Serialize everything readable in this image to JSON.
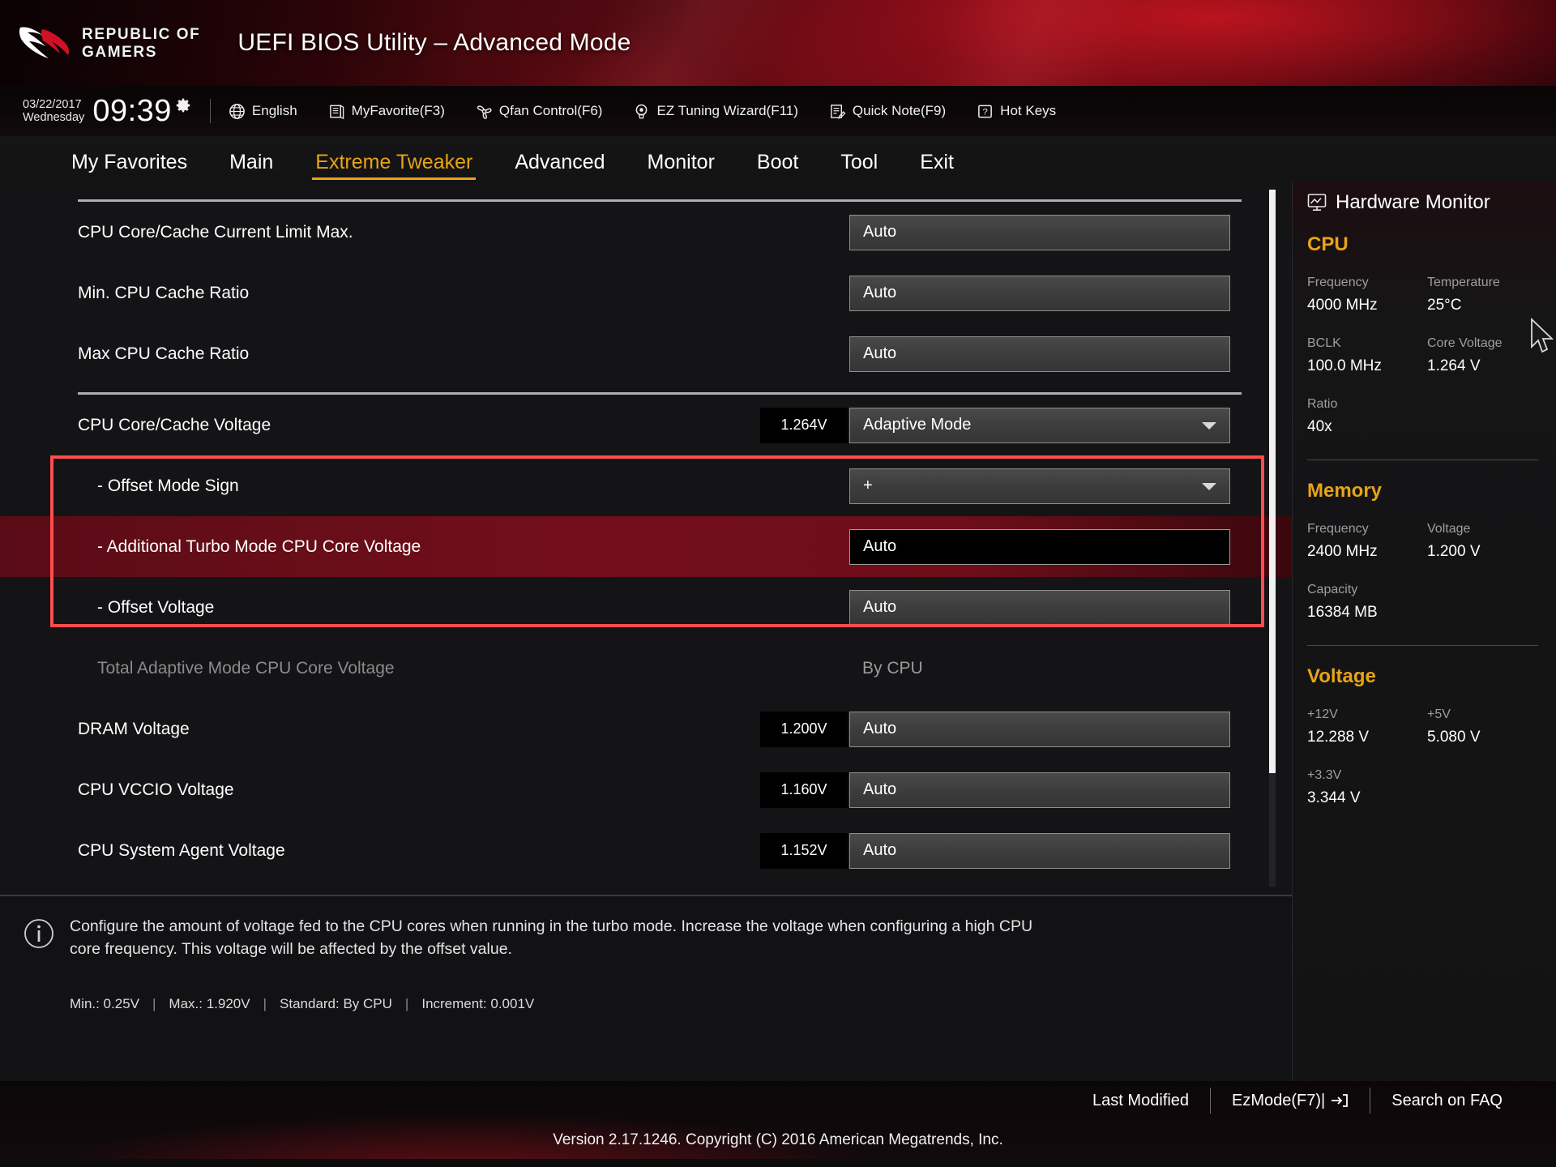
{
  "header": {
    "brand_line1": "REPUBLIC OF",
    "brand_line2": "GAMERS",
    "title": "UEFI BIOS Utility – Advanced Mode"
  },
  "toolbar": {
    "date": "03/22/2017",
    "weekday": "Wednesday",
    "time": "09:39",
    "items": [
      {
        "label": "English",
        "icon": "globe-icon"
      },
      {
        "label": "MyFavorite(F3)",
        "icon": "bookmark-icon"
      },
      {
        "label": "Qfan Control(F6)",
        "icon": "fan-icon"
      },
      {
        "label": "EZ Tuning Wizard(F11)",
        "icon": "wizard-icon"
      },
      {
        "label": "Quick Note(F9)",
        "icon": "note-icon"
      },
      {
        "label": "Hot Keys",
        "icon": "key-icon"
      }
    ]
  },
  "nav": {
    "tabs": [
      {
        "label": "My Favorites",
        "active": false
      },
      {
        "label": "Main",
        "active": false
      },
      {
        "label": "Extreme Tweaker",
        "active": true
      },
      {
        "label": "Advanced",
        "active": false
      },
      {
        "label": "Monitor",
        "active": false
      },
      {
        "label": "Boot",
        "active": false
      },
      {
        "label": "Tool",
        "active": false
      },
      {
        "label": "Exit",
        "active": false
      }
    ],
    "active_color": "#e8a317"
  },
  "settings": {
    "rows": [
      {
        "label": "CPU Core/Cache Current Limit Max.",
        "value": "Auto",
        "control": "field",
        "voltage": "",
        "sub": false,
        "dim": false,
        "selected": false
      },
      {
        "label": "Min. CPU Cache Ratio",
        "value": "Auto",
        "control": "field",
        "voltage": "",
        "sub": false,
        "dim": false,
        "selected": false
      },
      {
        "label": "Max CPU Cache Ratio",
        "value": "Auto",
        "control": "field",
        "voltage": "",
        "sub": false,
        "dim": false,
        "selected": false
      },
      {
        "label": "CPU Core/Cache Voltage",
        "value": "Adaptive Mode",
        "control": "dropdown",
        "voltage": "1.264V",
        "sub": false,
        "dim": false,
        "selected": false
      },
      {
        "label": "- Offset Mode Sign",
        "value": "+",
        "control": "dropdown",
        "voltage": "",
        "sub": true,
        "dim": false,
        "selected": false
      },
      {
        "label": "- Additional Turbo Mode CPU Core Voltage",
        "value": "Auto",
        "control": "field-dark",
        "voltage": "",
        "sub": true,
        "dim": false,
        "selected": true
      },
      {
        "label": "- Offset Voltage",
        "value": "Auto",
        "control": "field",
        "voltage": "",
        "sub": true,
        "dim": false,
        "selected": false
      },
      {
        "label": "Total Adaptive Mode CPU Core Voltage",
        "value": "By CPU",
        "control": "plain",
        "voltage": "",
        "sub": true,
        "dim": true,
        "selected": false
      },
      {
        "label": "DRAM Voltage",
        "value": "Auto",
        "control": "field",
        "voltage": "1.200V",
        "sub": false,
        "dim": false,
        "selected": false
      },
      {
        "label": "CPU VCCIO Voltage",
        "value": "Auto",
        "control": "field",
        "voltage": "1.160V",
        "sub": false,
        "dim": false,
        "selected": false
      },
      {
        "label": "CPU System Agent Voltage",
        "value": "Auto",
        "control": "field",
        "voltage": "1.152V",
        "sub": false,
        "dim": false,
        "selected": false
      }
    ],
    "callout_color": "#ff4d4d"
  },
  "help": {
    "text": "Configure the amount of voltage fed to the CPU cores when running in the turbo mode. Increase the voltage when configuring a high CPU core frequency. This voltage will be affected by the offset value.",
    "min": "Min.: 0.25V",
    "max": "Max.: 1.920V",
    "standard": "Standard: By CPU",
    "increment": "Increment: 0.001V",
    "separator": "|"
  },
  "hardware_monitor": {
    "title": "Hardware Monitor",
    "sections": [
      {
        "name": "CPU",
        "pairs": [
          {
            "k1": "Frequency",
            "v1": "4000 MHz",
            "k2": "Temperature",
            "v2": "25°C"
          },
          {
            "k1": "BCLK",
            "v1": "100.0 MHz",
            "k2": "Core Voltage",
            "v2": "1.264 V"
          },
          {
            "k1": "Ratio",
            "v1": "40x",
            "k2": "",
            "v2": ""
          }
        ]
      },
      {
        "name": "Memory",
        "pairs": [
          {
            "k1": "Frequency",
            "v1": "2400 MHz",
            "k2": "Voltage",
            "v2": "1.200 V"
          },
          {
            "k1": "Capacity",
            "v1": "16384 MB",
            "k2": "",
            "v2": ""
          }
        ]
      },
      {
        "name": "Voltage",
        "pairs": [
          {
            "k1": "+12V",
            "v1": "12.288 V",
            "k2": "+5V",
            "v2": "5.080 V"
          },
          {
            "k1": "+3.3V",
            "v1": "3.344 V",
            "k2": "",
            "v2": ""
          }
        ]
      }
    ],
    "accent_color": "#e8a317"
  },
  "footer": {
    "links": [
      {
        "label": "Last Modified"
      },
      {
        "label": "EzMode(F7)|"
      },
      {
        "label": "Search on FAQ"
      }
    ],
    "copyright": "Version 2.17.1246. Copyright (C) 2016 American Megatrends, Inc."
  }
}
